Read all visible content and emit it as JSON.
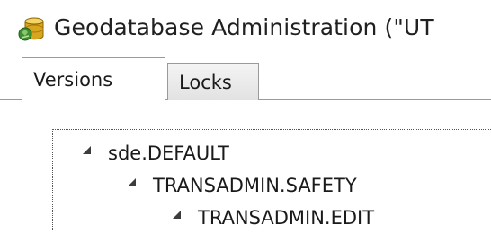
{
  "window": {
    "title": "Geodatabase Administration (\"UT",
    "icon": "geodatabase-administration-icon"
  },
  "tabs": [
    {
      "label": "Versions",
      "selected": true
    },
    {
      "label": "Locks",
      "selected": false
    }
  ],
  "version_tree": [
    {
      "label": "sde.DEFAULT",
      "expanded": true,
      "level": 0
    },
    {
      "label": "TRANSADMIN.SAFETY",
      "expanded": true,
      "level": 1
    },
    {
      "label": "TRANSADMIN.EDIT",
      "expanded": true,
      "level": 2
    }
  ],
  "colors": {
    "background": "#ffffff",
    "border": "#9a9a9a",
    "text": "#1a1a1a",
    "icon_gold": "#d7a51f",
    "icon_green": "#3f8f32"
  }
}
